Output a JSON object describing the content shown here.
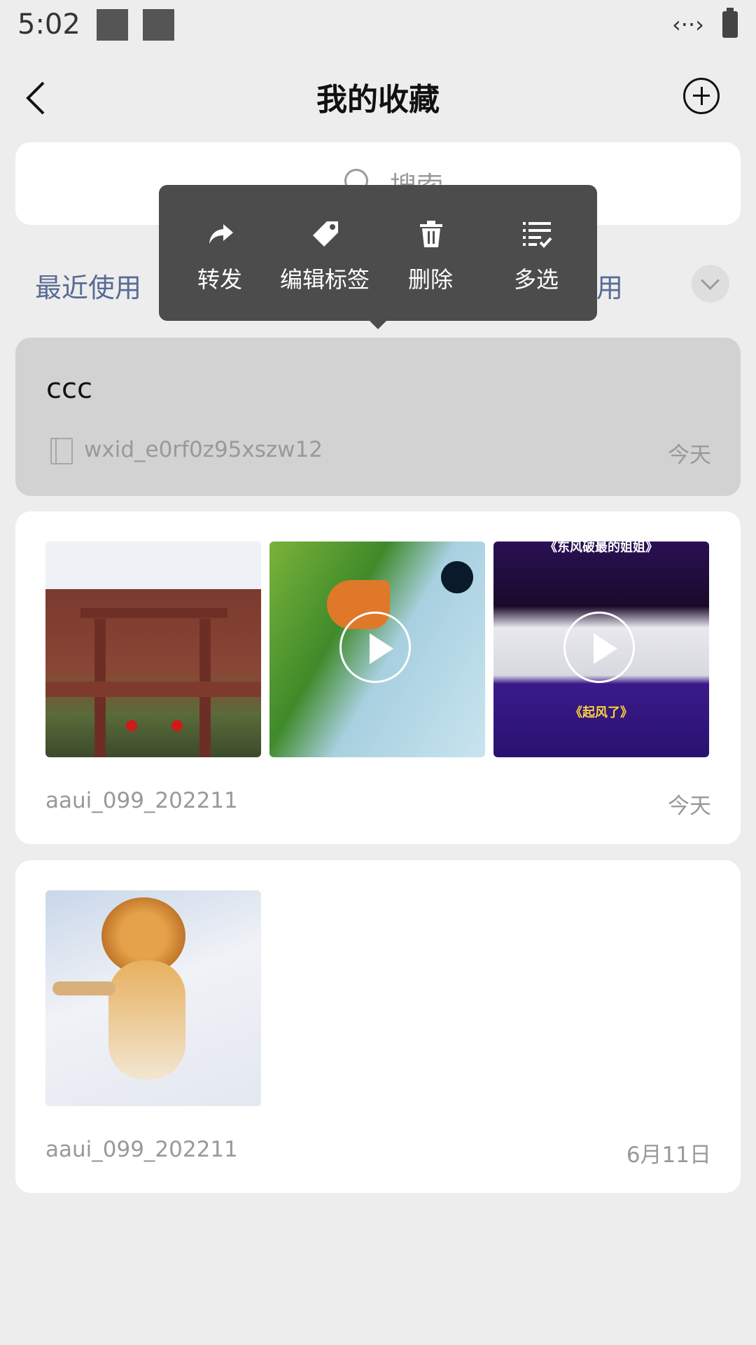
{
  "status_bar": {
    "time": "5:02",
    "network_icon": "data-arrows-icon",
    "battery_icon": "battery-icon"
  },
  "header": {
    "title": "我的收藏",
    "back_icon": "back-chevron-icon",
    "add_icon": "plus-circle-icon"
  },
  "search": {
    "placeholder": "搜索"
  },
  "filters": {
    "recent": "最近使用",
    "other_partial": "用"
  },
  "context_menu": {
    "items": [
      {
        "label": "转发",
        "icon": "share-forward-icon"
      },
      {
        "label": "编辑标签",
        "icon": "tag-icon"
      },
      {
        "label": "删除",
        "icon": "trash-icon"
      },
      {
        "label": "多选",
        "icon": "multi-select-icon"
      }
    ]
  },
  "items": [
    {
      "type": "text",
      "title": "ccc",
      "source": "wxid_e0rf0z95xszw12",
      "date": "今天"
    },
    {
      "type": "media",
      "media": [
        {
          "kind": "image",
          "desc": "archway-photo"
        },
        {
          "kind": "video",
          "desc": "duck-video"
        },
        {
          "kind": "video",
          "desc": "stage-video",
          "caption_top": "《东风破最的姐姐》",
          "caption_bottom": "《起风了》"
        }
      ],
      "source": "aaui_099_202211",
      "date": "今天"
    },
    {
      "type": "media",
      "media": [
        {
          "kind": "image",
          "desc": "tiger-photo"
        }
      ],
      "source": "aaui_099_202211",
      "date": "6月11日"
    }
  ]
}
